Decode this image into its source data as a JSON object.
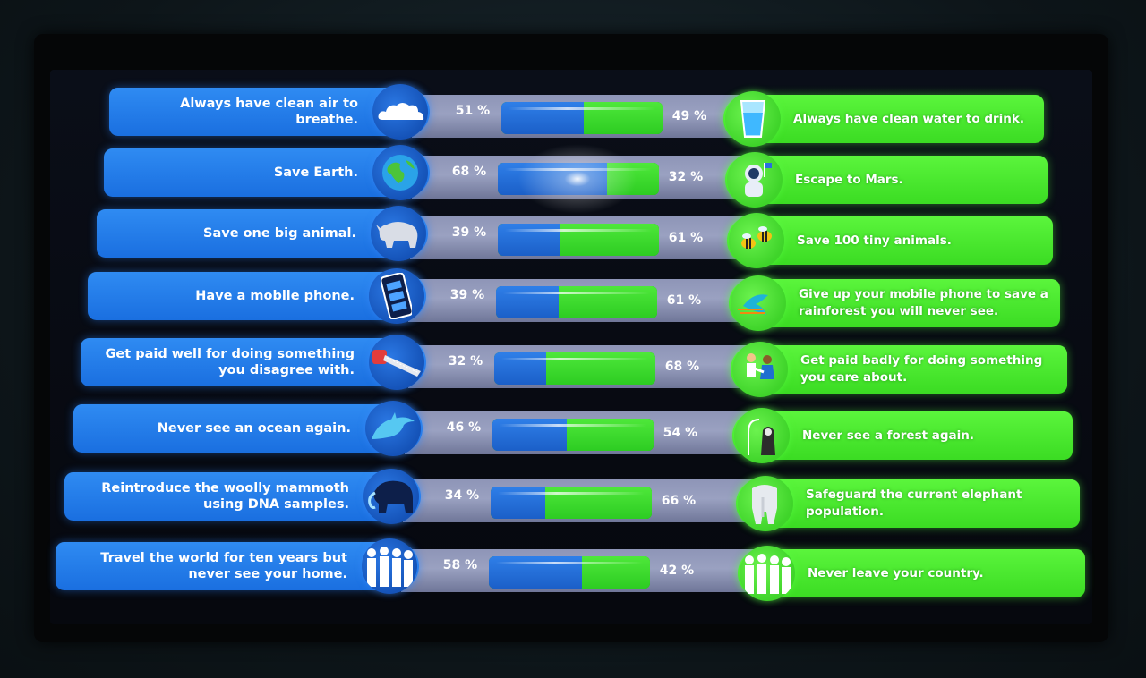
{
  "rows": [
    {
      "left": "Always have clean air to breathe.",
      "left_pct": "51 %",
      "right_pct": "49 %",
      "right": "Always have clean water to drink.",
      "left_value": 51,
      "right_value": 49,
      "left_icon": "cloud-icon",
      "right_icon": "water-glass-icon"
    },
    {
      "left": "Save Earth.",
      "left_pct": "68 %",
      "right_pct": "32 %",
      "right": "Escape to Mars.",
      "left_value": 68,
      "right_value": 32,
      "left_icon": "earth-icon",
      "right_icon": "astronaut-icon"
    },
    {
      "left": "Save one big animal.",
      "left_pct": "39 %",
      "right_pct": "61 %",
      "right": "Save 100 tiny animals.",
      "left_value": 39,
      "right_value": 61,
      "left_icon": "rhino-icon",
      "right_icon": "bees-icon"
    },
    {
      "left": "Have a mobile phone.",
      "left_pct": "39 %",
      "right_pct": "61 %",
      "right": "Give up your mobile phone to save a rainforest you will never see.",
      "left_value": 39,
      "right_value": 61,
      "left_icon": "mobile-phone-icon",
      "right_icon": "bird-icon"
    },
    {
      "left": "Get paid well for doing something you disagree with.",
      "left_pct": "32 %",
      "right_pct": "68 %",
      "right": "Get paid badly for doing something you care about.",
      "left_value": 32,
      "right_value": 68,
      "left_icon": "chainsaw-icon",
      "right_icon": "people-helping-icon"
    },
    {
      "left": "Never see an ocean again.",
      "left_pct": "46 %",
      "right_pct": "54 %",
      "right": "Never see a forest again.",
      "left_value": 46,
      "right_value": 54,
      "left_icon": "dolphin-icon",
      "right_icon": "forest-animal-icon"
    },
    {
      "left": "Reintroduce the woolly mammoth using DNA samples.",
      "left_pct": "34 %",
      "right_pct": "66 %",
      "right": "Safeguard the current elephant population.",
      "left_value": 34,
      "right_value": 66,
      "left_icon": "mammoth-icon",
      "right_icon": "elephant-icon"
    },
    {
      "left": "Travel the world for ten years but never see your home.",
      "left_pct": "58 %",
      "right_pct": "42 %",
      "right": "Never leave your country.",
      "left_value": 58,
      "right_value": 42,
      "left_icon": "crowd-icon",
      "right_icon": "crowd-icon"
    }
  ],
  "colors": {
    "left": "#1f74e6",
    "right": "#46e02c",
    "track": "#8e95b7"
  }
}
